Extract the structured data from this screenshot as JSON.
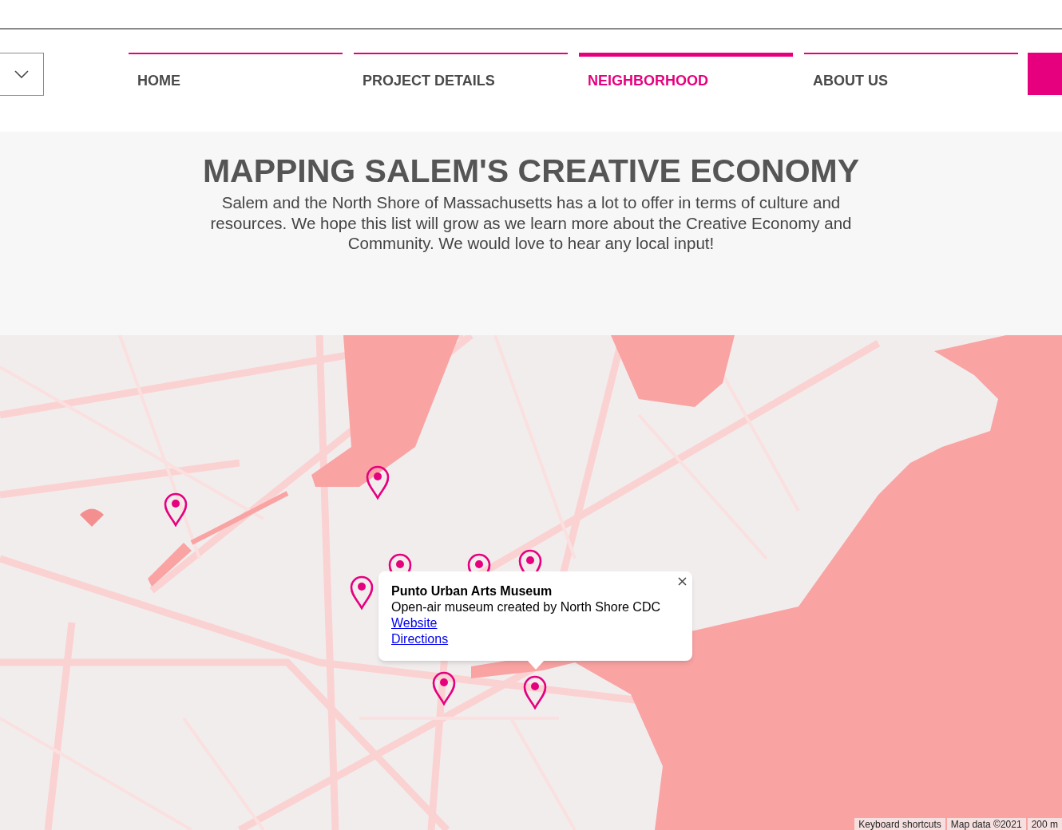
{
  "nav": {
    "tabs": [
      {
        "label": "HOME",
        "selected": false
      },
      {
        "label": "PROJECT DETAILS",
        "selected": false
      },
      {
        "label": "NEIGHBORHOOD",
        "selected": true
      },
      {
        "label": "ABOUT US",
        "selected": false
      }
    ]
  },
  "hero": {
    "title": "MAPPING SALEM'S CREATIVE ECONOMY",
    "description": "Salem and the North Shore of Massachusetts has a lot to offer in terms of culture and resources. We hope this list will grow as we learn more about the Creative Economy and Community. We would love to hear any local input!"
  },
  "map": {
    "info_window": {
      "title": "Punto Urban Arts Museum",
      "description": "Open-air museum created by North Shore CDC",
      "links": [
        "Website",
        "Directions"
      ]
    },
    "attribution": [
      "Keyboard shortcuts",
      "Map data ©2021",
      "200 m"
    ]
  }
}
